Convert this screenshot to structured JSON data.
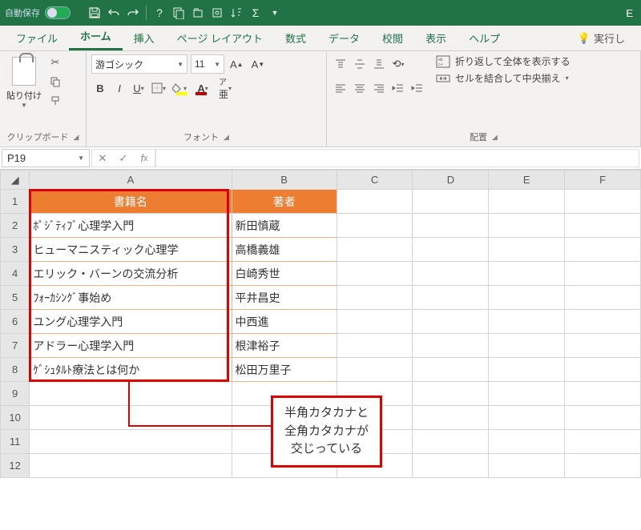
{
  "titlebar": {
    "autosave_label": "自動保存",
    "autosave_state": "オフ",
    "app_hint": "E"
  },
  "tabs": {
    "file": "ファイル",
    "home": "ホーム",
    "insert": "挿入",
    "pagelayout": "ページ レイアウト",
    "formulas": "数式",
    "data": "データ",
    "review": "校閲",
    "view": "表示",
    "help": "ヘルプ",
    "tell": "実行し"
  },
  "ribbon": {
    "clipboard": {
      "paste": "貼り付け",
      "label": "クリップボード"
    },
    "font": {
      "name": "游ゴシック",
      "size": "11",
      "label": "フォント"
    },
    "alignment": {
      "wrap": "折り返して全体を表示する",
      "merge": "セルを結合して中央揃え",
      "label": "配置"
    }
  },
  "namebox": {
    "value": "P19"
  },
  "columns": [
    "A",
    "B",
    "C",
    "D",
    "E",
    "F"
  ],
  "table": {
    "header": {
      "a": "書籍名",
      "b": "著者"
    },
    "rows": [
      {
        "a": "ﾎﾟｼﾞﾃｨﾌﾞ心理学入門",
        "b": "新田慎蔵"
      },
      {
        "a": "ヒューマニスティック心理学",
        "b": "高橋義雄"
      },
      {
        "a": "エリック・バーンの交流分析",
        "b": "白崎秀世"
      },
      {
        "a": "ﾌｫｰｶｼﾝｸﾞ事始め",
        "b": "平井昌史"
      },
      {
        "a": "ユング心理学入門",
        "b": "中西進"
      },
      {
        "a": "アドラー心理学入門",
        "b": "根津裕子"
      },
      {
        "a": "ｹﾞｼｭﾀﾙﾄ療法とは何か",
        "b": "松田万里子"
      }
    ]
  },
  "callout": {
    "line1": "半角カタカナと",
    "line2": "全角カタカナが",
    "line3": "交じっている"
  }
}
